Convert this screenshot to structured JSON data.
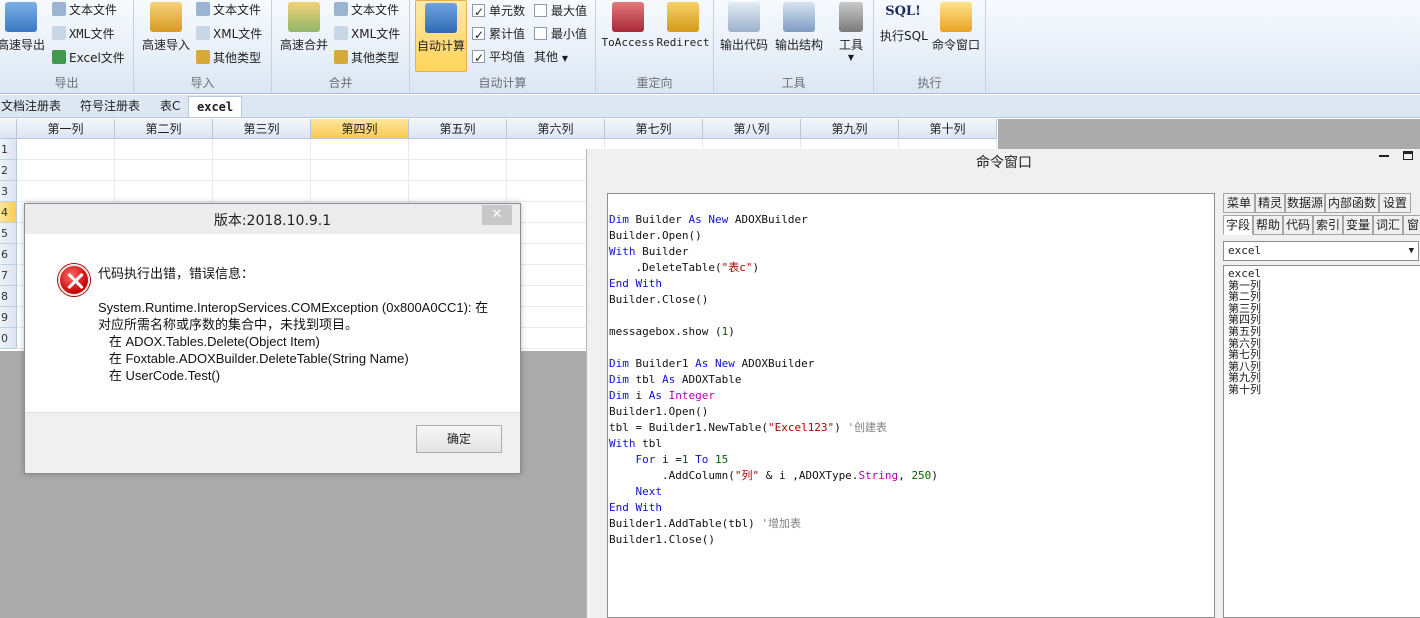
{
  "ribbon": {
    "export": {
      "big": "高速导出",
      "small": [
        "文本文件",
        "XML文件",
        "Excel文件"
      ],
      "label": "导出"
    },
    "import": {
      "big": "高速导入",
      "small": [
        "文本文件",
        "XML文件",
        "其他类型"
      ],
      "label": "导入"
    },
    "merge": {
      "big": "高速合并",
      "small": [
        "文本文件",
        "XML文件",
        "其他类型"
      ],
      "label": "合并"
    },
    "autocalc": {
      "big": "自动计算",
      "checks": [
        {
          "label": "单元数",
          "checked": true
        },
        {
          "label": "累计值",
          "checked": true
        },
        {
          "label": "平均值",
          "checked": true
        },
        {
          "label": "最大值",
          "checked": false
        },
        {
          "label": "最小值",
          "checked": false
        }
      ],
      "other": "其他",
      "label": "自动计算"
    },
    "redirect": {
      "toaccess": "ToAccess",
      "redirect": "Redirect",
      "label": "重定向"
    },
    "tools": {
      "outcode": "输出代码",
      "outstruct": "输出结构",
      "tools": "工具",
      "label": "工具"
    },
    "exec": {
      "sql": "执行SQL",
      "cmd": "命令窗口",
      "label": "执行",
      "sql_icon_text": "SQL!"
    }
  },
  "tabs": [
    "文档注册表",
    "符号注册表",
    "表C",
    "excel"
  ],
  "grid": {
    "columns": [
      "第一列",
      "第二列",
      "第三列",
      "第四列",
      "第五列",
      "第六列",
      "第七列",
      "第八列",
      "第九列",
      "第十列"
    ],
    "rows": [
      "1",
      "2",
      "3",
      "4",
      "5",
      "6",
      "7",
      "8",
      "9",
      "0"
    ]
  },
  "command_window": {
    "title": "命令窗口",
    "side_tabs_row1": [
      "菜单",
      "精灵",
      "数据源",
      "内部函数",
      "设置"
    ],
    "side_tabs_row2": [
      "字段",
      "帮助",
      "代码",
      "索引",
      "变量",
      "词汇",
      "窗口"
    ],
    "table_select": "excel",
    "field_list": [
      "excel",
      "第一列",
      "第二列",
      "第三列",
      "第四列",
      "第五列",
      "第六列",
      "第七列",
      "第八列",
      "第九列",
      "第十列"
    ]
  },
  "dialog": {
    "title": "版本:2018.10.9.1",
    "close": "✕",
    "heading": "代码执行出错，错误信息：",
    "lines": [
      "System.Runtime.InteropServices.COMException (0x800A0CC1): 在",
      "对应所需名称或序数的集合中，未找到项目。",
      "   在 ADOX.Tables.Delete(Object Item)",
      "   在 Foxtable.ADOXBuilder.DeleteTable(String Name)",
      "   在 UserCode.Test()"
    ],
    "ok": "确定"
  },
  "colors": {
    "selected_header": "#f8cc55",
    "ribbon_bg": "#e7eff8",
    "error_red": "#c70000",
    "keyword_blue": "#1010d0"
  }
}
